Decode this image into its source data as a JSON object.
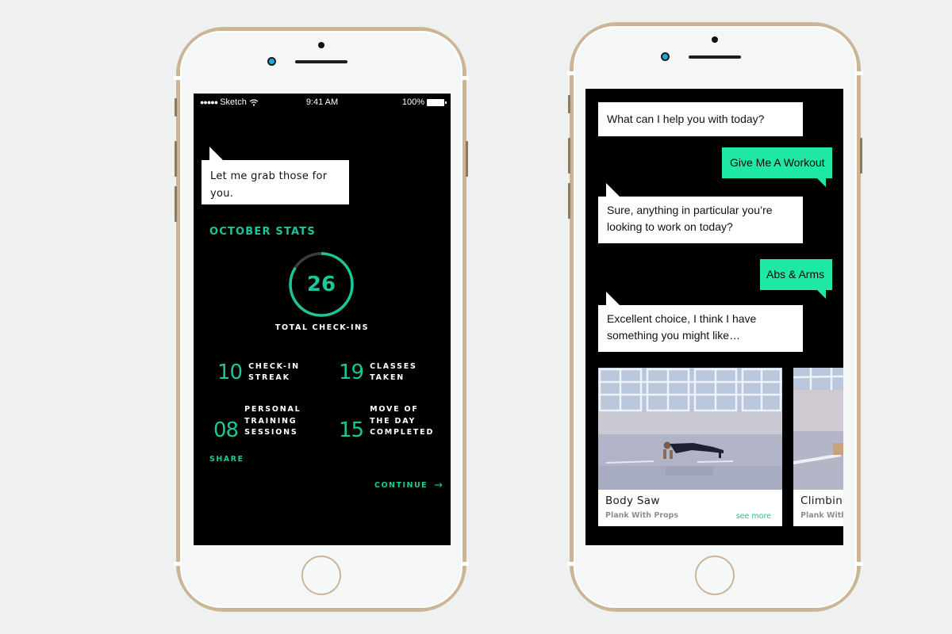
{
  "colors": {
    "accent": "#19c799",
    "bubble_green": "#1fe8a7",
    "frame_gold": "#cbb595",
    "background": "#eef1ef",
    "ring_track": "#3a3f42"
  },
  "left_phone": {
    "status_bar": {
      "signal_dots": "●●●●●",
      "carrier": "Sketch",
      "wifi_icon": "wifi-icon",
      "time": "9:41 AM",
      "battery_percent": "100%"
    },
    "bot_message": "Let me grab those for you.",
    "section_title": "OCTOBER STATS",
    "total_checkins": {
      "value": "26",
      "label": "TOTAL CHECK-INS",
      "progress_fraction": 0.84
    },
    "stats": [
      {
        "value": "10",
        "label": "CHECK-IN\nSTREAK"
      },
      {
        "value": "19",
        "label": "CLASSES\nTAKEN"
      },
      {
        "value": "08",
        "label": "PERSONAL\nTRAINING\nSESSIONS"
      },
      {
        "value": "15",
        "label": "MOVE OF\nTHE DAY\nCOMPLETED"
      }
    ],
    "share_label": "SHARE",
    "continue_label": "CONTINUE",
    "continue_icon": "→"
  },
  "right_phone": {
    "messages": [
      {
        "from": "bot",
        "text": "What can I help you with today?"
      },
      {
        "from": "user",
        "text": "Give Me A Workout"
      },
      {
        "from": "bot",
        "text": "Sure, anything in particular you’re looking to work on today?"
      },
      {
        "from": "user",
        "text": "Abs & Arms"
      },
      {
        "from": "bot",
        "text": "Excellent choice, I think I have something you might like…"
      }
    ],
    "cards": [
      {
        "title": "Body Saw",
        "subtitle": "Plank With Props",
        "more_label": "see more"
      },
      {
        "title": "Climbing",
        "subtitle": "Plank With Props"
      }
    ]
  }
}
